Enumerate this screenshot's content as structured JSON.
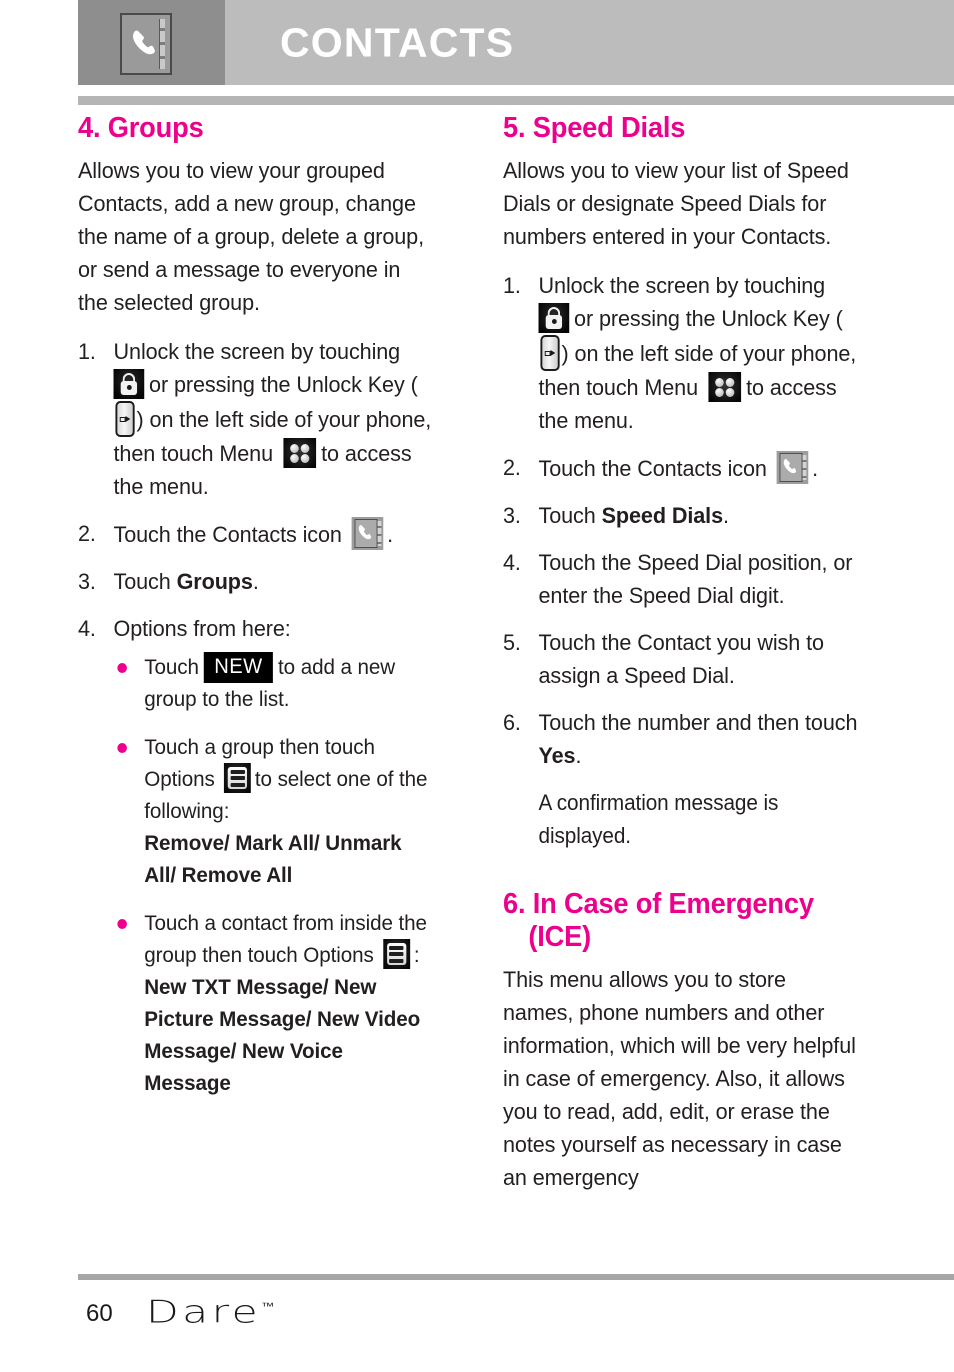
{
  "header": {
    "title": "CONTACTS",
    "icon": "contacts-book-icon"
  },
  "colors": {
    "accent_magenta": "#ec008c",
    "header_band": "#bcbcbc",
    "header_icon_box": "#8e8e8e",
    "rule_gray": "#b5b5b5",
    "body_text": "#231f20"
  },
  "left_column": {
    "heading": "4. Groups",
    "intro": "Allows you to view your grouped Contacts, add a new group, change the name of a group, delete a group, or send a message to everyone in the selected group.",
    "steps": [
      {
        "num": "1.",
        "part1": "Unlock the screen by touching",
        "icon1": "lock-icon",
        "part2": "or pressing the Unlock Key (",
        "icon2": "unlock-key-icon",
        "part3": ") on the left side of your phone, then touch Menu",
        "icon3": "menu-grid-icon",
        "part4": "to access the menu."
      },
      {
        "num": "2.",
        "part1": "Touch the Contacts icon",
        "icon1": "contacts-icon",
        "part2": "."
      },
      {
        "num": "3.",
        "part1": "Touch ",
        "bold1": "Groups",
        "part2": "."
      },
      {
        "num": "4.",
        "part1": "Options from here:"
      }
    ],
    "bullets": [
      {
        "part1": "Touch",
        "button": "NEW",
        "part2": "to add a new group to the list."
      },
      {
        "part1": "Touch a group then touch Options",
        "icon1": "options-list-icon",
        "part2": "to select one of the following:",
        "bold_list": "Remove/ Mark All/ Unmark All/ Remove All"
      },
      {
        "part1": "Touch a contact from inside the group then touch Options",
        "icon1": "options-list-icon",
        "part2": ":",
        "bold_list": "New TXT Message/ New Picture Message/ New Video Message/ New Voice Message"
      }
    ]
  },
  "right_column": {
    "heading": "5. Speed Dials",
    "intro": "Allows you to view your list of Speed Dials or designate Speed Dials for numbers entered in your Contacts.",
    "steps": [
      {
        "num": "1.",
        "part1": "Unlock the screen by touching",
        "icon1": "lock-icon",
        "part2": "or pressing the Unlock Key (",
        "icon2": "unlock-key-icon",
        "part3": ") on the left side of your phone, then touch Menu",
        "icon3": "menu-grid-icon",
        "part4": "to access the menu."
      },
      {
        "num": "2.",
        "part1": "Touch the Contacts icon",
        "icon1": "contacts-icon",
        "part2": "."
      },
      {
        "num": "3.",
        "part1": "Touch ",
        "bold1": "Speed Dials",
        "part2": "."
      },
      {
        "num": "4.",
        "part1": "Touch the Speed Dial position, or enter the Speed Dial digit."
      },
      {
        "num": "5.",
        "part1": "Touch the Contact you wish to assign a Speed Dial."
      },
      {
        "num": "6.",
        "part1": "Touch the number and then touch ",
        "bold1": "Yes",
        "part2": "."
      }
    ],
    "note": "A confirmation message is displayed.",
    "heading2_line1": "6. In Case of Emergency",
    "heading2_line2": "(ICE)",
    "intro2": "This menu allows you to store names, phone numbers and other information, which will be very helpful in case of emergency. Also, it allows you to read, add, edit, or erase the notes yourself as necessary in case an emergency"
  },
  "footer": {
    "page_number": "60",
    "brand": "Dare",
    "trademark": "™"
  }
}
